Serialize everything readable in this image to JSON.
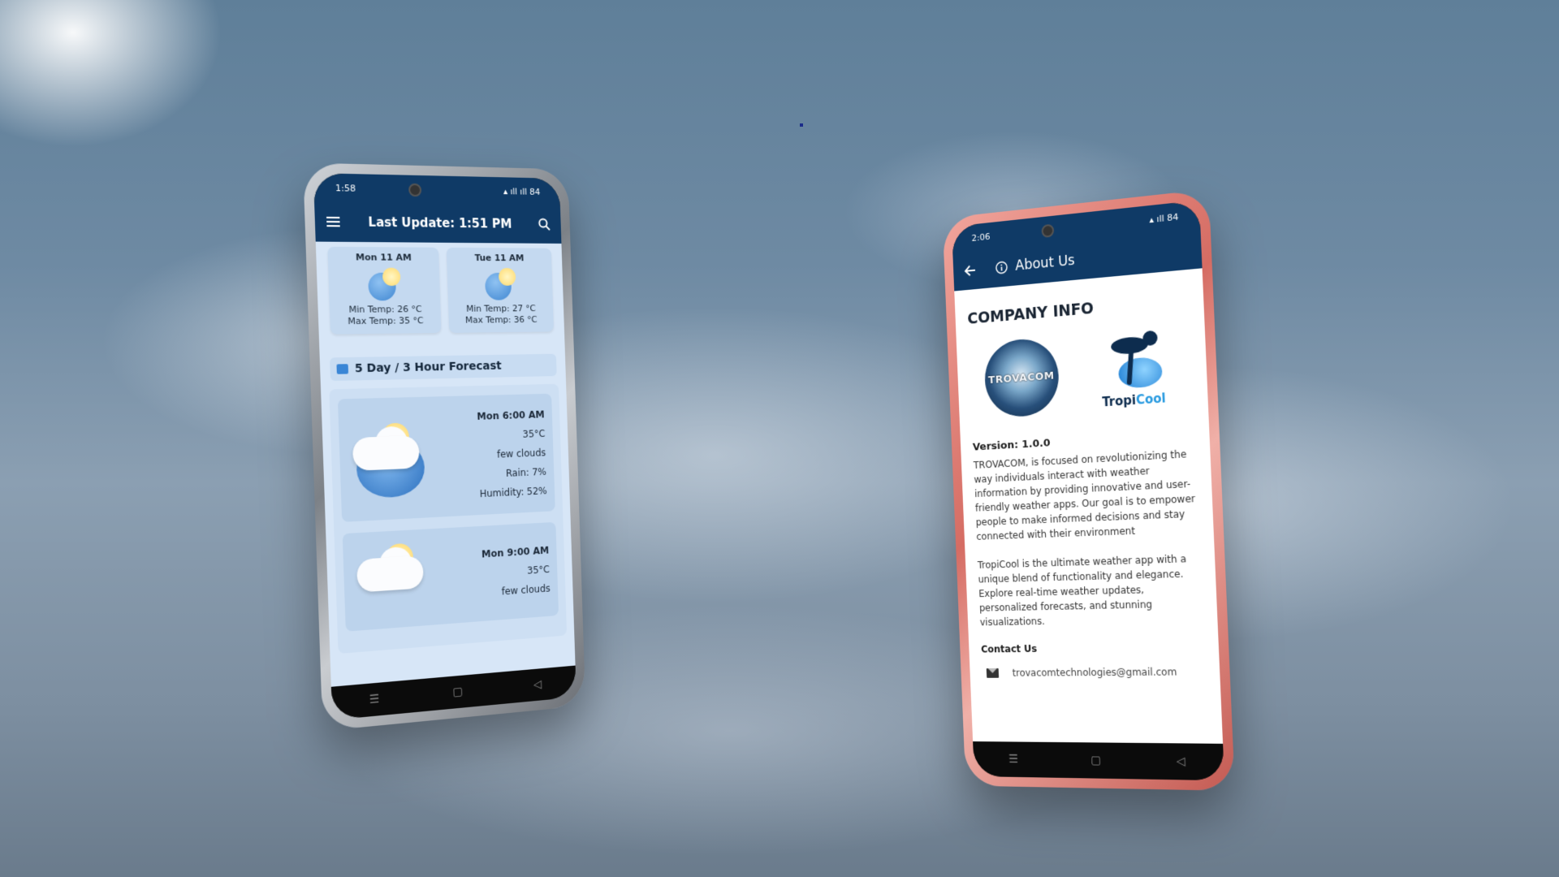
{
  "left_phone": {
    "status": {
      "time": "1:58",
      "battery": "84"
    },
    "app_bar": {
      "title": "Last Update: 1:51 PM"
    },
    "daily": [
      {
        "day": "Mon 11 AM",
        "min": "Min Temp: 26 °C",
        "max": "Max Temp: 35 °C"
      },
      {
        "day": "Tue 11 AM",
        "min": "Min Temp: 27 °C",
        "max": "Max Temp: 36 °C"
      }
    ],
    "section_title": "5 Day / 3 Hour Forecast",
    "forecast": [
      {
        "time": "Mon 6:00 AM",
        "temp": "35°C",
        "desc": "few clouds",
        "rain": "Rain: 7%",
        "humidity": "Humidity: 52%"
      },
      {
        "time": "Mon 9:00 AM",
        "temp": "35°C",
        "desc": "few clouds"
      }
    ]
  },
  "right_phone": {
    "status": {
      "time": "2:06",
      "battery": "84"
    },
    "app_bar": {
      "title": "About Us"
    },
    "company_title": "COMPANY INFO",
    "logos": {
      "trovacom": "TROVACOM",
      "tropicool_a": "Tropi",
      "tropicool_b": "Cool"
    },
    "version": "Version: 1.0.0",
    "para1": "TROVACOM, is focused on revolutionizing the way individuals interact with weather information by providing innovative and user-friendly weather apps. Our goal is to empower people to make informed decisions and stay connected with their environment",
    "para2": "TropiCool is the ultimate weather app with a unique blend of functionality and elegance. Explore real-time weather updates, personalized forecasts, and stunning visualizations.",
    "contact_title": "Contact Us",
    "email": "trovacomtechnologies@gmail.com"
  },
  "colors": {
    "app_bar": "#0f3a66",
    "left_bg": "#d7e6f7",
    "accent": "#2a9be0"
  },
  "icons": [
    "menu-icon",
    "search-icon",
    "back-arrow-icon",
    "info-icon",
    "mail-icon",
    "chart-icon",
    "sun-cloud-icon",
    "palm-icon"
  ]
}
